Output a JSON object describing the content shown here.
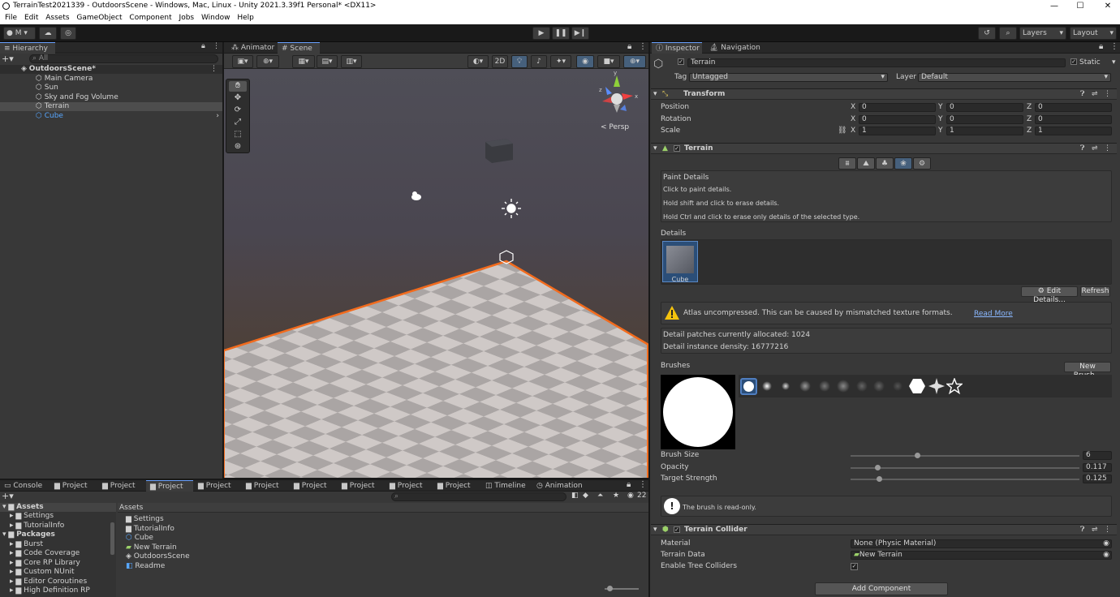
{
  "window": {
    "title": "TerrainTest2021339 - OutdoorsScene - Windows, Mac, Linux - Unity 2021.3.39f1 Personal* <DX11>",
    "minimize": "—",
    "maximize": "☐",
    "close": "✕"
  },
  "menu": [
    "File",
    "Edit",
    "Assets",
    "GameObject",
    "Component",
    "Jobs",
    "Window",
    "Help"
  ],
  "toolbar": {
    "account": "M",
    "layers": "Layers",
    "layout": "Layout"
  },
  "hierarchy": {
    "tab": "Hierarchy",
    "search_placeholder": "All",
    "scene": "OutdoorsScene*",
    "items": [
      "Main Camera",
      "Sun",
      "Sky and Fog Volume",
      "Terrain",
      "Cube"
    ]
  },
  "scene_tabs": [
    "Animator",
    "Scene"
  ],
  "scene_view": {
    "mode_2d": "2D",
    "persp": "< Persp",
    "x_axis": "x",
    "y_axis": "y",
    "z_axis": "z"
  },
  "bottom_tabs": [
    "Console",
    "Project",
    "Project",
    "Project",
    "Project",
    "Project",
    "Project",
    "Project",
    "Project",
    "Project",
    "Timeline",
    "Animation"
  ],
  "project": {
    "hidden_count": "22",
    "tree": [
      {
        "label": "Assets",
        "bold": true
      },
      {
        "label": "Settings"
      },
      {
        "label": "TutorialInfo"
      },
      {
        "label": "Packages",
        "bold": true
      },
      {
        "label": "Burst"
      },
      {
        "label": "Code Coverage"
      },
      {
        "label": "Core RP Library"
      },
      {
        "label": "Custom NUnit"
      },
      {
        "label": "Editor Coroutines"
      },
      {
        "label": "High Definition RP"
      }
    ],
    "assets_header": "Assets",
    "assets": [
      "Settings",
      "TutorialInfo",
      "Cube",
      "New Terrain",
      "OutdoorsScene",
      "Readme"
    ]
  },
  "inspector": {
    "tabs": [
      "Inspector",
      "Navigation"
    ],
    "object_name": "Terrain",
    "static_label": "Static",
    "tag_label": "Tag",
    "tag_value": "Untagged",
    "layer_label": "Layer",
    "layer_value": "Default",
    "transform": {
      "title": "Transform",
      "rows": [
        {
          "label": "Position",
          "x": "0",
          "y": "0",
          "z": "0"
        },
        {
          "label": "Rotation",
          "x": "0",
          "y": "0",
          "z": "0"
        },
        {
          "label": "Scale",
          "x": "1",
          "y": "1",
          "z": "1"
        }
      ],
      "axis": [
        "X",
        "Y",
        "Z"
      ]
    },
    "terrain": {
      "title": "Terrain",
      "paint_title": "Paint Details",
      "hints": [
        "Click to paint details.",
        "Hold shift and click to erase details.",
        "Hold Ctrl and click to erase only details of the selected type."
      ],
      "details_label": "Details",
      "detail_item": "Cube",
      "edit_details": "Edit Details...",
      "refresh": "Refresh",
      "warning": "Atlas uncompressed. This can be caused by mismatched texture formats.",
      "read_more": "Read More",
      "patches": "Detail patches currently allocated: 1024",
      "density": "Detail instance density: 16777216",
      "brushes_label": "Brushes",
      "new_brush": "New Brush...",
      "brush_size_label": "Brush Size",
      "brush_size": "6",
      "brush_size_frac": 0.29,
      "opacity_label": "Opacity",
      "opacity": "0.117",
      "opacity_frac": 0.117,
      "strength_label": "Target Strength",
      "strength": "0.125",
      "strength_frac": 0.125,
      "readonly": "The brush is read-only."
    },
    "collider": {
      "title": "Terrain Collider",
      "material_label": "Material",
      "material_value": "None (Physic Material)",
      "data_label": "Terrain Data",
      "data_value": "New Terrain",
      "trees_label": "Enable Tree Colliders"
    },
    "add_component": "Add Component"
  },
  "colors": {
    "accent": "#6aa1ff",
    "selection_outline": "#f26b1d",
    "warning": "#f4c20d"
  }
}
